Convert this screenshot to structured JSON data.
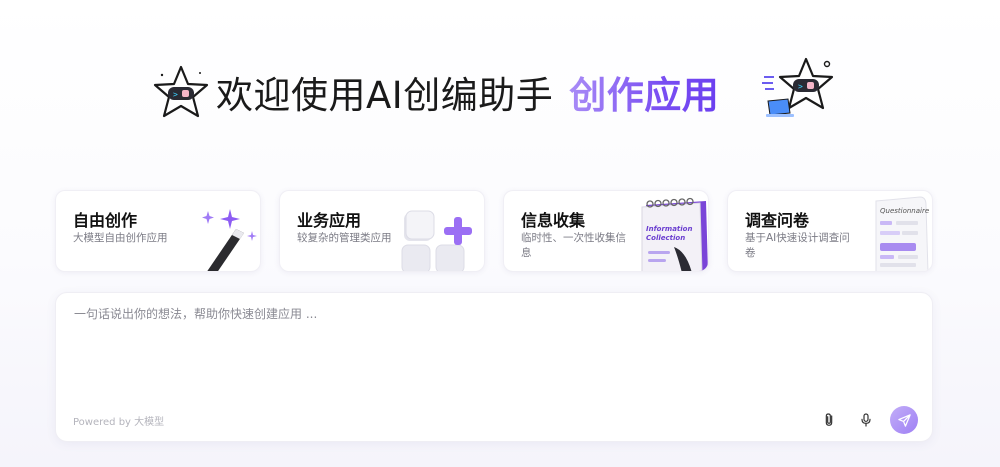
{
  "hero": {
    "title_main": "欢迎使用AI创编助手",
    "title_accent": "创作应用",
    "mascot_left_icon": "robot-star-mascot-icon",
    "mascot_right_icon": "robot-star-laptop-mascot-icon"
  },
  "cards": [
    {
      "title": "自由创作",
      "desc": "大模型自由创作应用",
      "icon": "magic-wand-sparkles-icon"
    },
    {
      "title": "业务应用",
      "desc": "较复杂的管理类应用",
      "icon": "blocks-plus-icon"
    },
    {
      "title": "信息收集",
      "desc": "临时性、一次性收集信息",
      "icon": "notebook-icon",
      "art_text_1": "Information",
      "art_text_2": "Collection"
    },
    {
      "title": "调查问卷",
      "desc": "基于AI快速设计调查问卷",
      "icon": "questionnaire-sheet-icon",
      "art_text": "Questionnaire"
    }
  ],
  "prompt": {
    "placeholder": "一句话说出你的想法，帮助你快速创建应用 ...",
    "value": "",
    "powered_by": "Powered by 大模型",
    "attach_icon": "paperclip-icon",
    "mic_icon": "microphone-icon",
    "send_icon": "send-arrow-icon"
  },
  "colors": {
    "accent_start": "#a98cf6",
    "accent_end": "#6b3ff0",
    "send_button": "#a88bf5"
  }
}
